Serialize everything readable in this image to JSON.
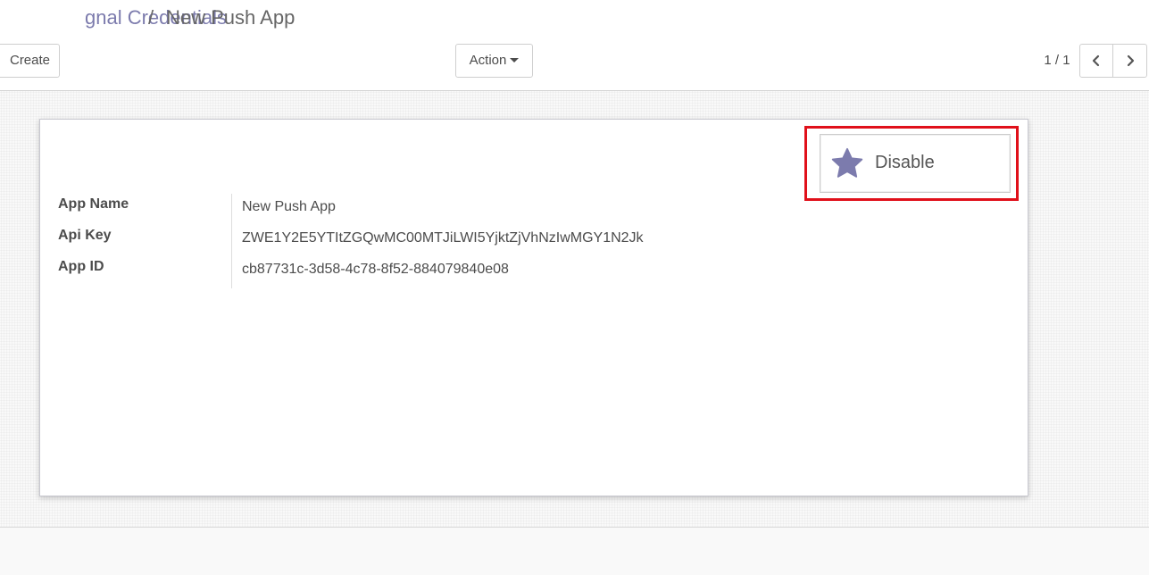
{
  "breadcrumb": {
    "parent": "gnal Credentials",
    "separator": "/",
    "current": "New Push App"
  },
  "toolbar": {
    "create_label": "Create",
    "action_label": "Action"
  },
  "pager": {
    "value": "1 / 1"
  },
  "status_button": {
    "label": "Disable",
    "icon": "star-icon",
    "icon_color": "#7c7bad"
  },
  "fields": [
    {
      "label": "App Name",
      "value": "New Push App"
    },
    {
      "label": "Api Key",
      "value": "ZWE1Y2E5YTItZGQwMC00MTJiLWI5YjktZjVhNzIwMGY1N2Jk"
    },
    {
      "label": "App ID",
      "value": "cb87731c-3d58-4c78-8f52-884079840e08"
    }
  ],
  "colors": {
    "accent": "#7c7bad",
    "highlight": "#e0101a"
  }
}
